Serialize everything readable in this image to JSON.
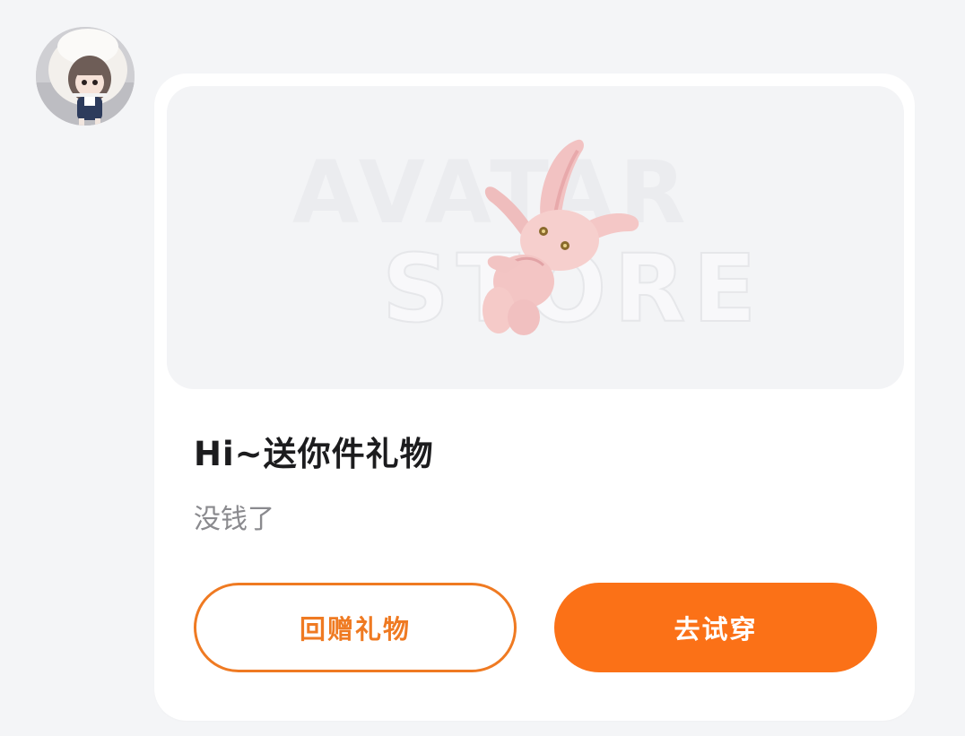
{
  "sender": {
    "avatar_icon": "avatar-girl-icon"
  },
  "gift_card": {
    "preview": {
      "watermark_line1": "AVATAR",
      "watermark_line2": "STORE",
      "item_icon": "pink-bunny-plush-icon"
    },
    "title": "Hi~送你件礼物",
    "message": "没钱了",
    "buttons": {
      "return_gift_label": "回赠礼物",
      "try_on_label": "去试穿"
    }
  },
  "colors": {
    "accent": "#fb7117",
    "outline": "#ef7a22",
    "background": "#f4f5f7",
    "card": "#ffffff"
  }
}
